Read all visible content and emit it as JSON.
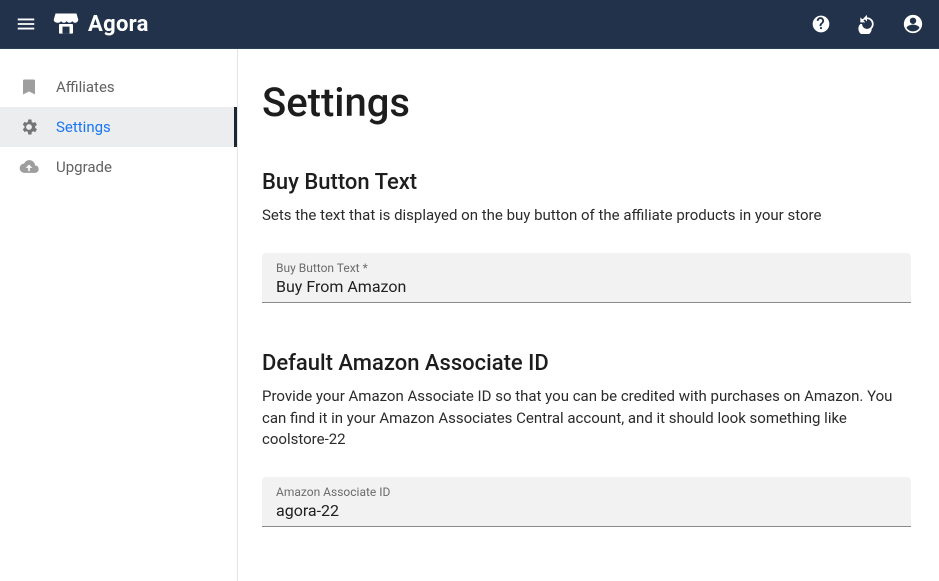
{
  "brand": {
    "name": "Agora"
  },
  "sidebar": {
    "items": [
      {
        "label": "Affiliates"
      },
      {
        "label": "Settings"
      },
      {
        "label": "Upgrade"
      }
    ]
  },
  "page": {
    "title": "Settings"
  },
  "sections": {
    "buyButton": {
      "heading": "Buy Button Text",
      "description": "Sets the text that is displayed on the buy button of the affiliate products in your store",
      "field_label": "Buy Button Text *",
      "field_value": "Buy From Amazon"
    },
    "associateId": {
      "heading": "Default Amazon Associate ID",
      "description": "Provide your Amazon Associate ID so that you can be credited with purchases on Amazon. You can find it in your Amazon Associates Central account, and it should look something like coolstore-22",
      "field_label": "Amazon Associate ID",
      "field_value": "agora-22"
    }
  }
}
